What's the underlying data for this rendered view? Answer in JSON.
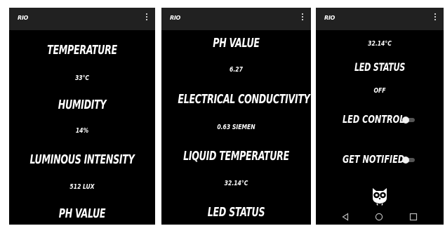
{
  "app": {
    "title": "RIO"
  },
  "screen1": {
    "temperature_label": "TEMPERATURE",
    "temperature_value": "33°C",
    "humidity_label": "HUMIDITY",
    "humidity_value": "14%",
    "luminous_label": "LUMINOUS INTENSITY",
    "luminous_value": "512 LUX",
    "ph_label": "PH VALUE"
  },
  "screen2": {
    "ph_label": "PH VALUE",
    "ph_value": "6.27",
    "ec_label": "ELECTRICAL CONDUCTIVITY",
    "ec_value": "0.63 SIEMEN",
    "liquid_temp_label": "LIQUID TEMPERATURE",
    "liquid_temp_value": "32.14°C",
    "led_status_label": "LED STATUS"
  },
  "screen3": {
    "liquid_temp_value": "32.14°C",
    "led_status_label": "LED STATUS",
    "led_status_value": "OFF",
    "led_control_label": "LED CONTROL",
    "led_control_on": false,
    "notify_label": "GET NOTIFIED",
    "notify_on": false
  },
  "icons": {
    "menu": "more-vert-icon",
    "logo": "owl-logo-icon",
    "back": "back-icon",
    "home": "home-icon",
    "recents": "recents-icon"
  },
  "colors": {
    "background": "#000000",
    "appbar": "#212121",
    "text": "#ffffff"
  }
}
